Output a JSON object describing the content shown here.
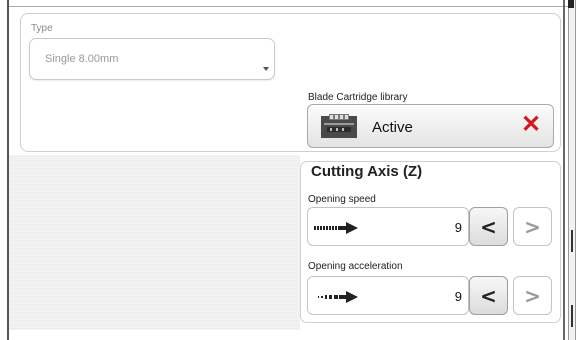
{
  "type_field": {
    "label": "Type",
    "value": "Single 8.00mm"
  },
  "blade_cartridge": {
    "label": "Blade Cartridge library",
    "status": "Active",
    "icon": "blade-cartridge-icon",
    "clear_icon": "close-x-icon",
    "clear_color": "#d9141c"
  },
  "cutting_axis": {
    "title": "Cutting Axis (Z)",
    "fields": [
      {
        "label": "Opening speed",
        "value": "9",
        "icon": "speed-arrow-icon",
        "dec_symbol": "<",
        "inc_symbol": ">"
      },
      {
        "label": "Opening acceleration",
        "value": "9",
        "icon": "acceleration-arrow-icon",
        "dec_symbol": "<",
        "inc_symbol": ">"
      }
    ]
  }
}
